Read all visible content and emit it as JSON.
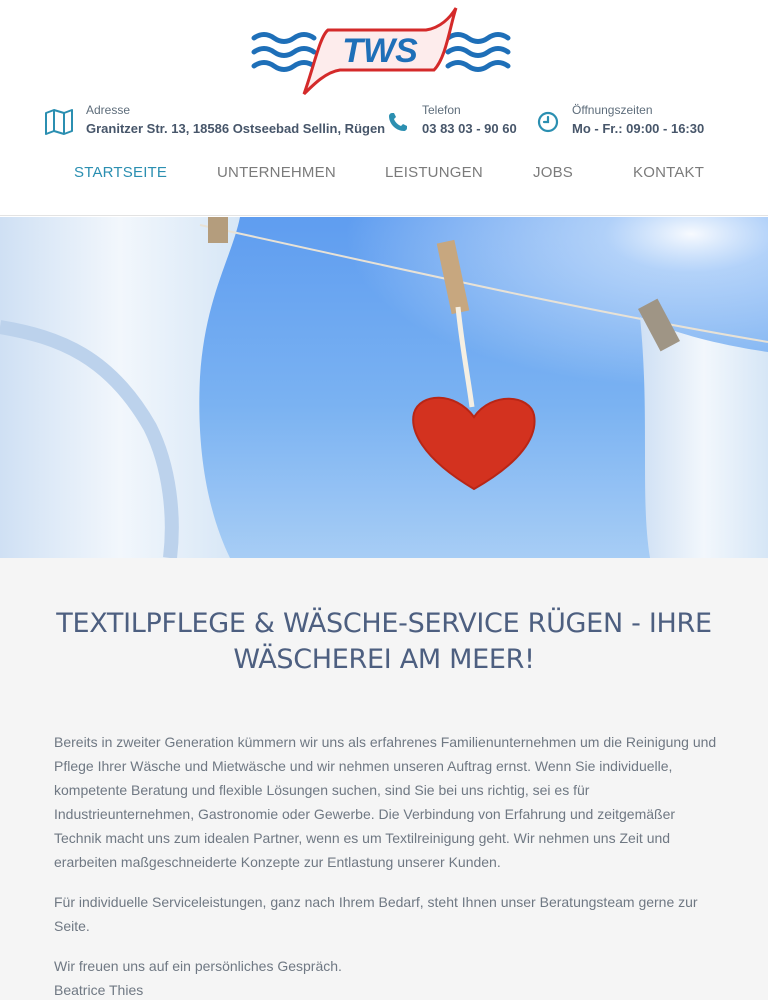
{
  "brand": {
    "logo_text": "TWS",
    "accent": "#2b8fb1",
    "logo_blue": "#1e6fb8",
    "logo_red": "#d42a2a"
  },
  "contact": {
    "address_label": "Adresse",
    "address_value": "Granitzer Str. 13, 18586 Ostseebad Sellin, Rügen",
    "address_icon": "map-icon",
    "phone_label": "Telefon",
    "phone_value": "03 83 03 - 90 60",
    "phone_icon": "phone-icon",
    "hours_label": "Öffnungszeiten",
    "hours_value": "Mo - Fr.: 09:00 - 16:30",
    "hours_icon": "clock-icon"
  },
  "nav": {
    "items": [
      {
        "label": "STARTSEITE",
        "active": true
      },
      {
        "label": "UNTERNEHMEN",
        "active": false
      },
      {
        "label": "LEISTUNGEN",
        "active": false
      },
      {
        "label": "JOBS",
        "active": false
      },
      {
        "label": "KONTAKT",
        "active": false
      }
    ]
  },
  "main": {
    "headline_line1": "TEXTILPFLEGE & WÄSCHE-SERVICE RÜGEN - IHRE",
    "headline_line2": "WÄSCHEREI AM MEER!",
    "paragraph1": "Bereits in zweiter Generation kümmern wir uns als erfahrenes Familienunternehmen um die Reinigung und Pflege Ihrer Wäsche und Mietwäsche und wir nehmen unseren Auftrag ernst. Wenn Sie individuelle, kompetente Beratung und flexible Lösungen suchen, sind Sie bei uns richtig, sei es für Industrieunternehmen, Gastronomie oder Gewerbe. Die Verbindung von Erfahrung und zeitgemäßer Technik macht uns zum idealen Partner, wenn es um Textilreinigung geht. Wir nehmen uns Zeit und erarbeiten maßgeschneiderte Konzepte zur Entlastung unserer Kunden.",
    "paragraph2": "Für individuelle Serviceleistungen, ganz nach Ihrem Bedarf, steht Ihnen unser Beratungsteam gerne zur Seite.",
    "paragraph3_line1": "Wir freuen uns auf ein persönliches Gespräch.",
    "paragraph3_line2": "Beatrice Thies"
  }
}
